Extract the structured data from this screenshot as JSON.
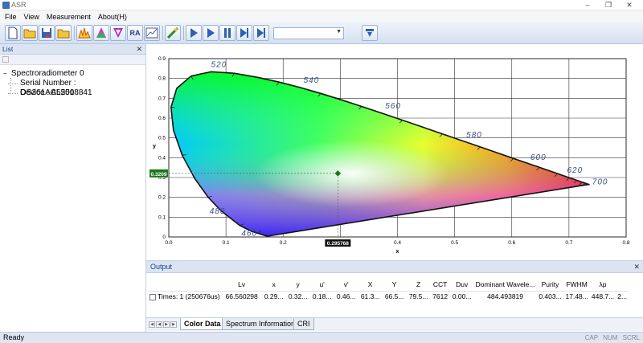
{
  "window": {
    "title": "ASR"
  },
  "menu": [
    "File",
    "View",
    "Measurement",
    "About(H)"
  ],
  "toolbar": {
    "buttons": [
      "new-file-icon",
      "open-folder-icon",
      "save-icon",
      "folder-icon",
      "spectrum-icon",
      "color-triangle-icon",
      "color-triangle-alt-icon",
      "ra-button",
      "graph-icon",
      "settings-icon",
      "play-icon",
      "play-continuous-icon",
      "pause-icon",
      "next-icon",
      "stop-icon"
    ],
    "ra_label": "RA",
    "combo_value": "",
    "colors": {
      "accent": "#3a6fb0",
      "toolbar_bg": "#dbe6f6"
    }
  },
  "list_panel": {
    "title": "List",
    "tree": {
      "root": "Spectroradiometer 0",
      "children": [
        "Serial Number : OS361AC55018841",
        "Device : AL250"
      ]
    }
  },
  "chart_data": {
    "type": "scatter",
    "title": "",
    "xlabel": "x",
    "ylabel": "y",
    "xlim": [
      0.0,
      0.8
    ],
    "ylim": [
      0.0,
      0.9
    ],
    "x_ticks": [
      "0.0",
      "0.1",
      "0.2",
      "0.3",
      "0.4",
      "0.5",
      "0.6",
      "0.7",
      "0.8"
    ],
    "y_ticks": [
      "0",
      "0.1",
      "0.2",
      "0.3",
      "0.4",
      "0.5",
      "0.6",
      "0.7",
      "0.8",
      "0.9"
    ],
    "grid": true,
    "locus_labels": [
      {
        "label": "460",
        "x": 0.144,
        "y": 0.03
      },
      {
        "label": "480",
        "x": 0.091,
        "y": 0.133
      },
      {
        "label": "520",
        "x": 0.074,
        "y": 0.834
      },
      {
        "label": "540",
        "x": 0.23,
        "y": 0.754
      },
      {
        "label": "560",
        "x": 0.373,
        "y": 0.624
      },
      {
        "label": "580",
        "x": 0.512,
        "y": 0.487
      },
      {
        "label": "600",
        "x": 0.627,
        "y": 0.373
      },
      {
        "label": "620",
        "x": 0.691,
        "y": 0.308
      },
      {
        "label": "700",
        "x": 0.735,
        "y": 0.265
      }
    ],
    "point": {
      "x": 0.295768,
      "y": 0.3209,
      "x_label": "0.295768",
      "y_label": "0.3209",
      "color": "#1a7a1a"
    }
  },
  "output": {
    "title": "Output",
    "columns": [
      "",
      "Lv",
      "x",
      "y",
      "u'",
      "v'",
      "X",
      "Y",
      "Z",
      "CCT",
      "Duv",
      "Dominant Wavele...",
      "Purity",
      "FWHM",
      "λp",
      ""
    ],
    "rows": [
      [
        "Times: 1 (250676us)",
        "66.560298",
        "0.29...",
        "0.32...",
        "0.18...",
        "0.46...",
        "61.3...",
        "66.5...",
        "79.5...",
        "7612",
        "0.00...",
        "484.493819",
        "0.403...",
        "17.48...",
        "448.7...",
        "2..."
      ]
    ],
    "tabs": [
      "Color Data",
      "Spectrum Information",
      "CRI"
    ]
  },
  "status": {
    "text": "Ready",
    "indicators": [
      "CAP",
      "NUM",
      "SCRL"
    ]
  }
}
